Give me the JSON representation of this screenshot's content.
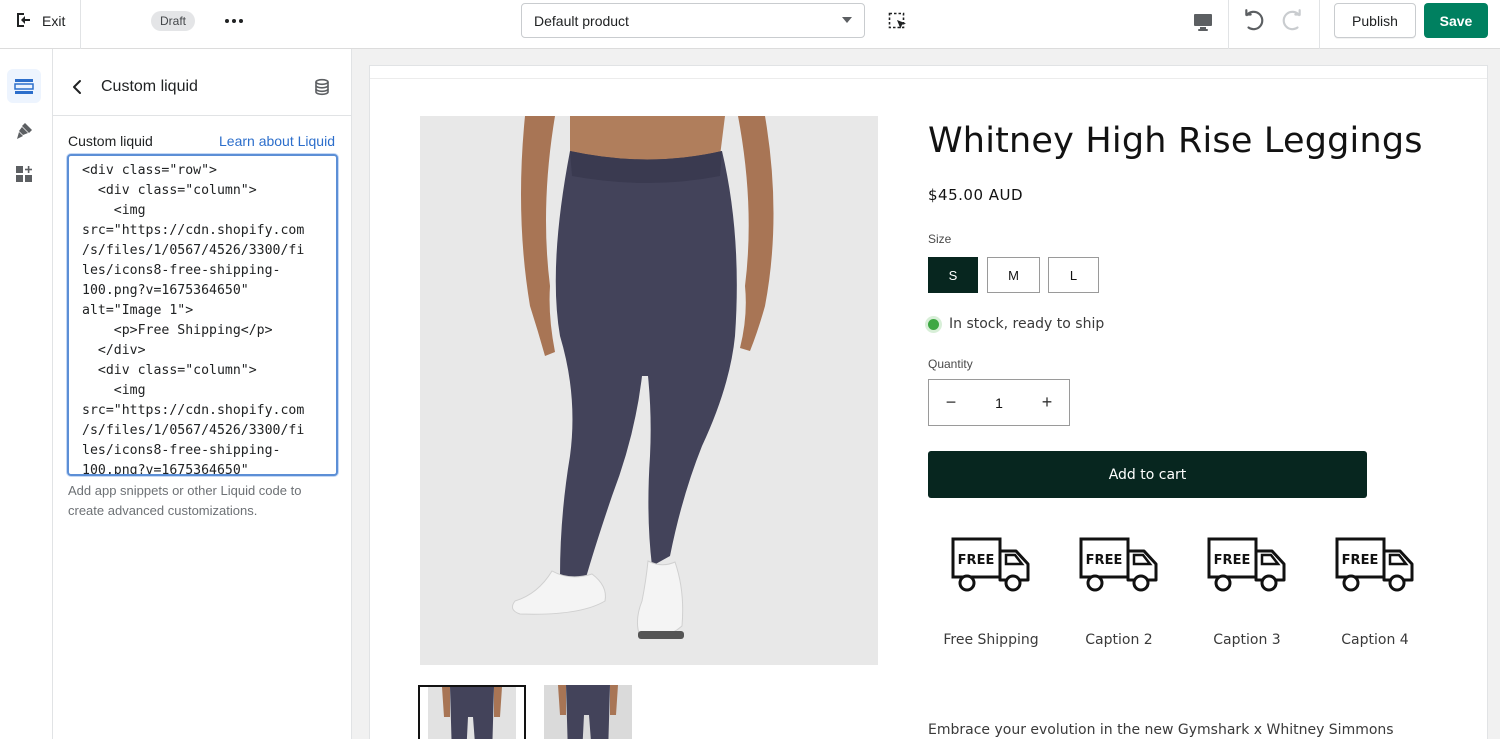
{
  "topbar": {
    "exit_label": "Exit",
    "draft_label": "Draft",
    "product_select_value": "Default product",
    "publish_label": "Publish",
    "save_label": "Save"
  },
  "sidebar_rail": {
    "items": [
      "sections-icon",
      "theme-settings-icon",
      "app-embeds-icon"
    ],
    "active": "sections-icon"
  },
  "panel": {
    "title": "Custom liquid",
    "field_label": "Custom liquid",
    "learn_link": "Learn about Liquid",
    "code": "<div class=\"row\">\n  <div class=\"column\">\n    <img\nsrc=\"https://cdn.shopify.com\n/s/files/1/0567/4526/3300/fi\nles/icons8-free-shipping-\n100.png?v=1675364650\"\nalt=\"Image 1\">\n    <p>Free Shipping</p>\n  </div>\n  <div class=\"column\">\n    <img\nsrc=\"https://cdn.shopify.com\n/s/files/1/0567/4526/3300/fi\nles/icons8-free-shipping-\n100.png?v=1675364650\"",
    "help_text": "Add app snippets or other Liquid code to create advanced customizations."
  },
  "product": {
    "title": "Whitney High Rise Leggings",
    "price": "$45.00 AUD",
    "size_label": "Size",
    "sizes": [
      "S",
      "M",
      "L"
    ],
    "selected_size": "S",
    "stock_text": "In stock, ready to ship",
    "quantity_label": "Quantity",
    "quantity": "1",
    "qty_minus": "−",
    "qty_plus": "+",
    "add_to_cart": "Add to cart",
    "description": "Embrace your evolution in the new Gymshark x Whitney Simmons"
  },
  "shipping_badges": [
    {
      "icon_text": "FREE",
      "caption": "Free Shipping"
    },
    {
      "icon_text": "FREE",
      "caption": "Caption 2"
    },
    {
      "icon_text": "FREE",
      "caption": "Caption 3"
    },
    {
      "icon_text": "FREE",
      "caption": "Caption 4"
    }
  ],
  "colors": {
    "save_green": "#008060",
    "link_blue": "#2c6ecb",
    "product_dark": "#07261f",
    "legging_navy": "#43435a",
    "stock_green": "#3ea743"
  }
}
